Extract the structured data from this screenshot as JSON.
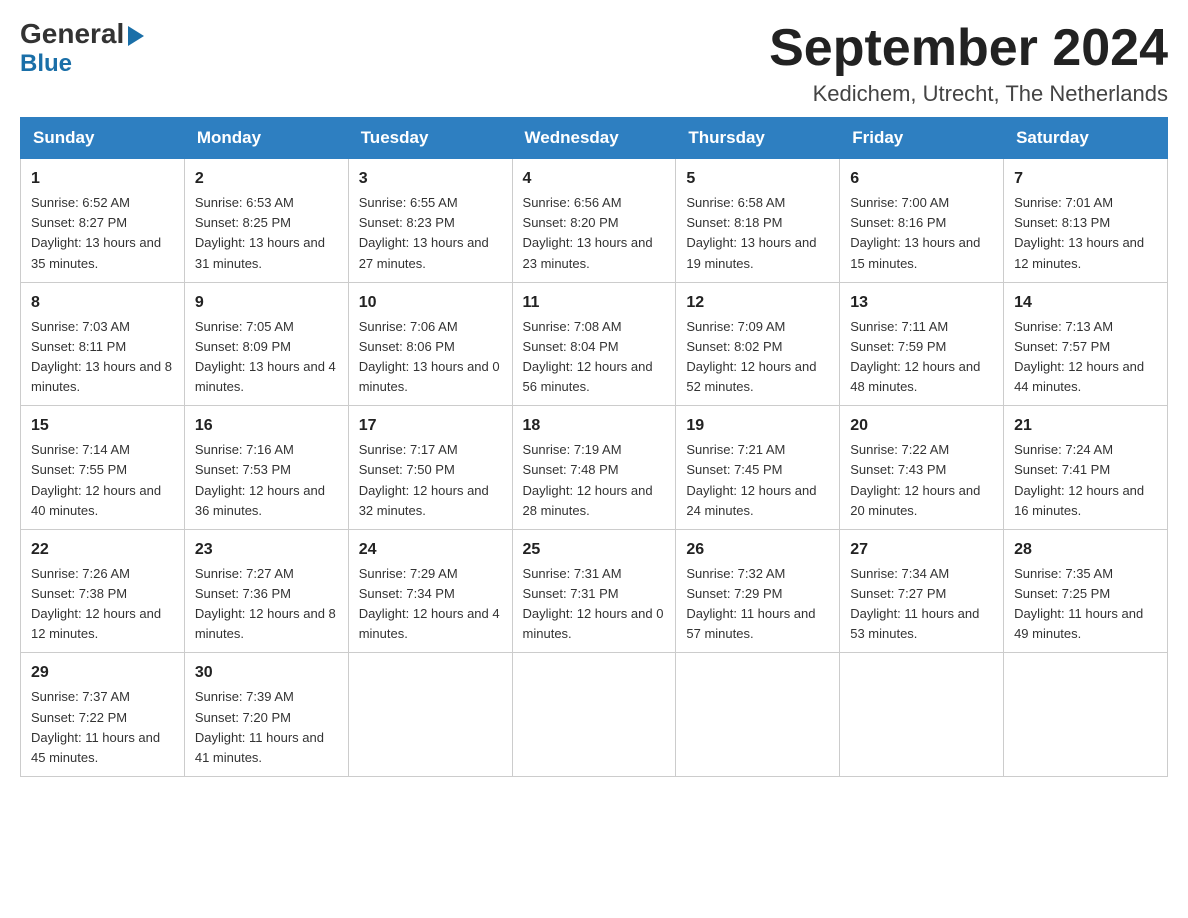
{
  "header": {
    "logo_general": "General",
    "logo_blue": "Blue",
    "month_year": "September 2024",
    "location": "Kedichem, Utrecht, The Netherlands"
  },
  "weekdays": [
    "Sunday",
    "Monday",
    "Tuesday",
    "Wednesday",
    "Thursday",
    "Friday",
    "Saturday"
  ],
  "weeks": [
    [
      {
        "day": "1",
        "sunrise": "6:52 AM",
        "sunset": "8:27 PM",
        "daylight": "13 hours and 35 minutes."
      },
      {
        "day": "2",
        "sunrise": "6:53 AM",
        "sunset": "8:25 PM",
        "daylight": "13 hours and 31 minutes."
      },
      {
        "day": "3",
        "sunrise": "6:55 AM",
        "sunset": "8:23 PM",
        "daylight": "13 hours and 27 minutes."
      },
      {
        "day": "4",
        "sunrise": "6:56 AM",
        "sunset": "8:20 PM",
        "daylight": "13 hours and 23 minutes."
      },
      {
        "day": "5",
        "sunrise": "6:58 AM",
        "sunset": "8:18 PM",
        "daylight": "13 hours and 19 minutes."
      },
      {
        "day": "6",
        "sunrise": "7:00 AM",
        "sunset": "8:16 PM",
        "daylight": "13 hours and 15 minutes."
      },
      {
        "day": "7",
        "sunrise": "7:01 AM",
        "sunset": "8:13 PM",
        "daylight": "13 hours and 12 minutes."
      }
    ],
    [
      {
        "day": "8",
        "sunrise": "7:03 AM",
        "sunset": "8:11 PM",
        "daylight": "13 hours and 8 minutes."
      },
      {
        "day": "9",
        "sunrise": "7:05 AM",
        "sunset": "8:09 PM",
        "daylight": "13 hours and 4 minutes."
      },
      {
        "day": "10",
        "sunrise": "7:06 AM",
        "sunset": "8:06 PM",
        "daylight": "13 hours and 0 minutes."
      },
      {
        "day": "11",
        "sunrise": "7:08 AM",
        "sunset": "8:04 PM",
        "daylight": "12 hours and 56 minutes."
      },
      {
        "day": "12",
        "sunrise": "7:09 AM",
        "sunset": "8:02 PM",
        "daylight": "12 hours and 52 minutes."
      },
      {
        "day": "13",
        "sunrise": "7:11 AM",
        "sunset": "7:59 PM",
        "daylight": "12 hours and 48 minutes."
      },
      {
        "day": "14",
        "sunrise": "7:13 AM",
        "sunset": "7:57 PM",
        "daylight": "12 hours and 44 minutes."
      }
    ],
    [
      {
        "day": "15",
        "sunrise": "7:14 AM",
        "sunset": "7:55 PM",
        "daylight": "12 hours and 40 minutes."
      },
      {
        "day": "16",
        "sunrise": "7:16 AM",
        "sunset": "7:53 PM",
        "daylight": "12 hours and 36 minutes."
      },
      {
        "day": "17",
        "sunrise": "7:17 AM",
        "sunset": "7:50 PM",
        "daylight": "12 hours and 32 minutes."
      },
      {
        "day": "18",
        "sunrise": "7:19 AM",
        "sunset": "7:48 PM",
        "daylight": "12 hours and 28 minutes."
      },
      {
        "day": "19",
        "sunrise": "7:21 AM",
        "sunset": "7:45 PM",
        "daylight": "12 hours and 24 minutes."
      },
      {
        "day": "20",
        "sunrise": "7:22 AM",
        "sunset": "7:43 PM",
        "daylight": "12 hours and 20 minutes."
      },
      {
        "day": "21",
        "sunrise": "7:24 AM",
        "sunset": "7:41 PM",
        "daylight": "12 hours and 16 minutes."
      }
    ],
    [
      {
        "day": "22",
        "sunrise": "7:26 AM",
        "sunset": "7:38 PM",
        "daylight": "12 hours and 12 minutes."
      },
      {
        "day": "23",
        "sunrise": "7:27 AM",
        "sunset": "7:36 PM",
        "daylight": "12 hours and 8 minutes."
      },
      {
        "day": "24",
        "sunrise": "7:29 AM",
        "sunset": "7:34 PM",
        "daylight": "12 hours and 4 minutes."
      },
      {
        "day": "25",
        "sunrise": "7:31 AM",
        "sunset": "7:31 PM",
        "daylight": "12 hours and 0 minutes."
      },
      {
        "day": "26",
        "sunrise": "7:32 AM",
        "sunset": "7:29 PM",
        "daylight": "11 hours and 57 minutes."
      },
      {
        "day": "27",
        "sunrise": "7:34 AM",
        "sunset": "7:27 PM",
        "daylight": "11 hours and 53 minutes."
      },
      {
        "day": "28",
        "sunrise": "7:35 AM",
        "sunset": "7:25 PM",
        "daylight": "11 hours and 49 minutes."
      }
    ],
    [
      {
        "day": "29",
        "sunrise": "7:37 AM",
        "sunset": "7:22 PM",
        "daylight": "11 hours and 45 minutes."
      },
      {
        "day": "30",
        "sunrise": "7:39 AM",
        "sunset": "7:20 PM",
        "daylight": "11 hours and 41 minutes."
      },
      null,
      null,
      null,
      null,
      null
    ]
  ]
}
